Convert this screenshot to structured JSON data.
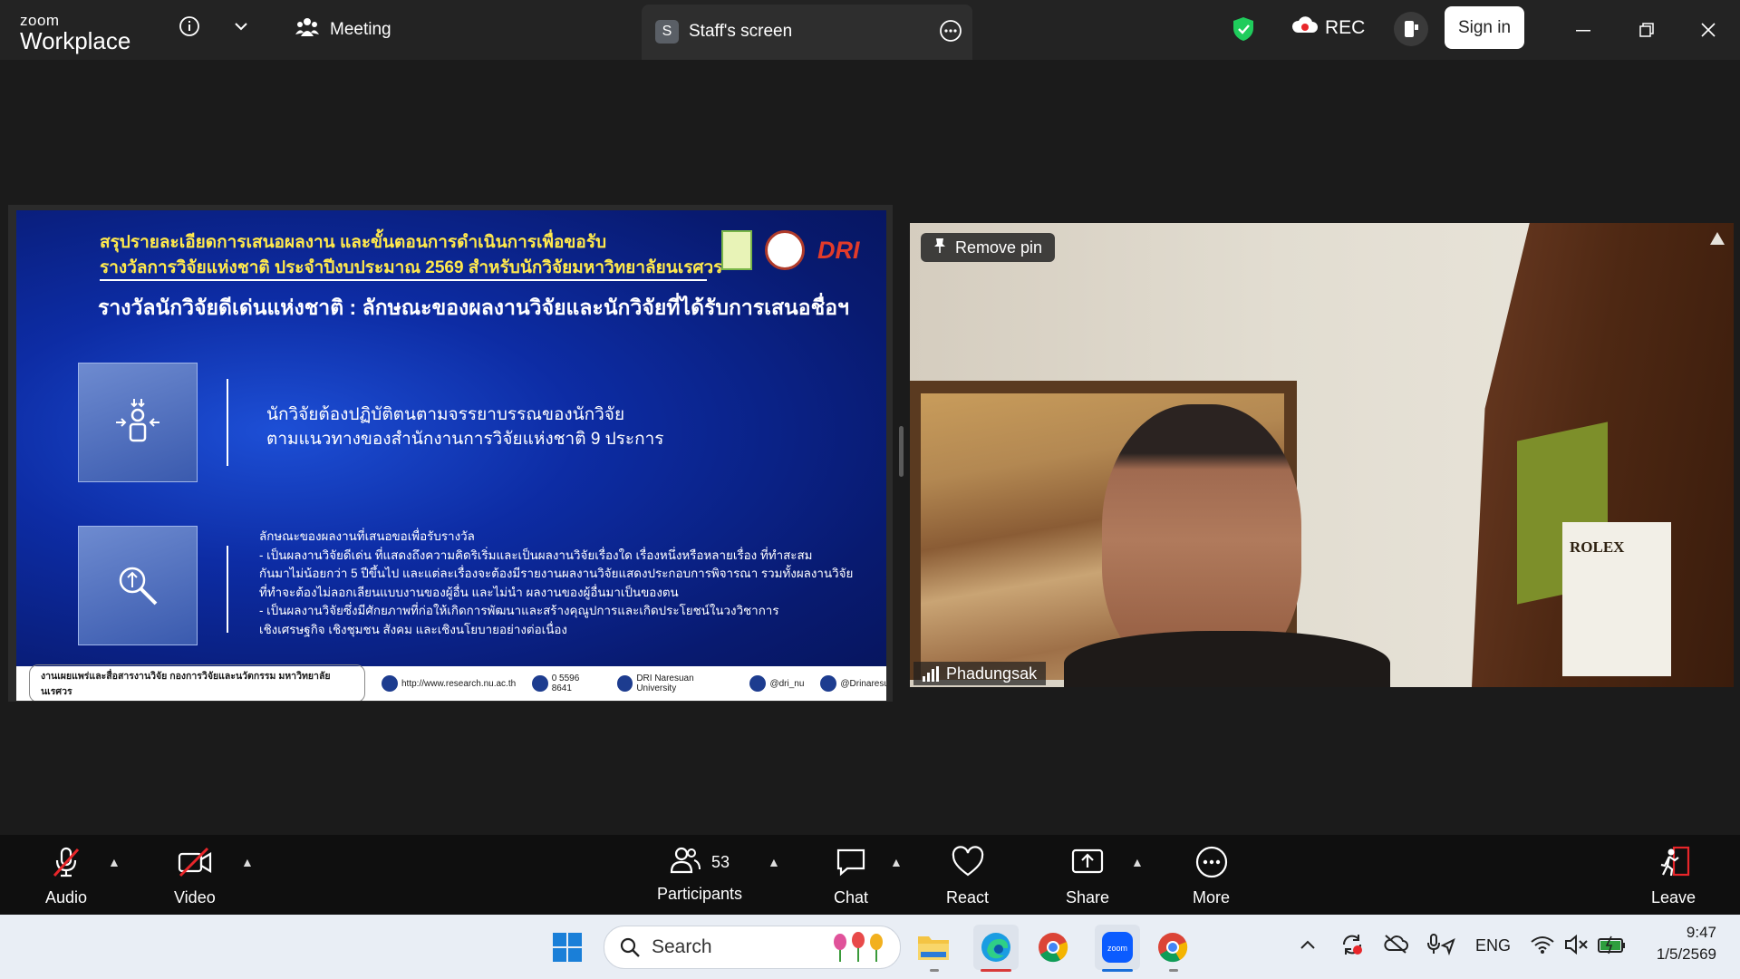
{
  "window": {
    "brand_top": "zoom",
    "brand_bottom": "Workplace",
    "meeting_tab": "Meeting",
    "share_tab_letter": "S",
    "share_tab": "Staff's screen",
    "rec_label": "REC",
    "signin_label": "Sign in"
  },
  "slide": {
    "title_line1": "สรุปรายละเอียดการเสนอผลงาน และขั้นตอนการดำเนินการเพื่อขอรับ",
    "title_line2": "รางวัลการวิจัยแห่งชาติ ประจำปีงบประมาณ 2569 สำหรับนักวิจัยมหาวิทยาลัยนเรศวร",
    "heading": "รางวัลนักวิจัยดีเด่นแห่งชาติ : ลักษณะของผลงานวิจัยและนักวิจัยที่ได้รับการเสนอชื่อฯ",
    "logo_label": "DRI",
    "block1_line1": "นักวิจัยต้องปฏิบัติตนตามจรรยาบรรณของนักวิจัย",
    "block1_line2": "ตามแนวทางของสำนักงานการวิจัยแห่งชาติ 9 ประการ",
    "block2_lines": [
      "ลักษณะของผลงานที่เสนอขอเพื่อรับรางวัล",
      "- เป็นผลงานวิจัยดีเด่น ที่แสดงถึงความคิดริเริ่มและเป็นผลงานวิจัยเรื่องใด เรื่องหนึ่งหรือหลายเรื่อง ที่ทำสะสม",
      "  กันมาไม่น้อยกว่า 5 ปีขึ้นไป และแต่ละเรื่องจะต้องมีรายงานผลงานวิจัยแสดงประกอบการพิจารณา รวมทั้งผลงานวิจัย",
      "  ที่ทำจะต้องไม่ลอกเลียนแบบงานของผู้อื่น และไม่นำ ผลงานของผู้อื่นมาเป็นของตน",
      "- เป็นผลงานวิจัยซึ่งมีศักยภาพที่ก่อให้เกิดการพัฒนาและสร้างคุณูปการและเกิดประโยชน์ในวงวิชาการ",
      "  เชิงเศรษฐกิจ เชิงชุมชน สังคม และเชิงนโยบายอย่างต่อเนื่อง"
    ],
    "footer_org": "งานเผยแพร่และสื่อสารงานวิจัย กองการวิจัยและนวัตกรรม มหาวิทยาลัยนเรศวร",
    "footer_web": "http://www.research.nu.ac.th",
    "footer_phone": "0 5596 8641",
    "footer_fb": "DRI Naresuan University",
    "footer_line": "@dri_nu",
    "footer_x": "@Drinaresuan"
  },
  "video": {
    "pin_label": "Remove pin",
    "participant_name": "Phadungsak",
    "bg_text": "ROLEX"
  },
  "controls": {
    "audio": "Audio",
    "video": "Video",
    "participants": "Participants",
    "participants_count": "53",
    "chat": "Chat",
    "react": "React",
    "share": "Share",
    "more": "More",
    "leave": "Leave"
  },
  "taskbar": {
    "search_placeholder": "Search",
    "lang": "ENG",
    "time": "9:47",
    "date": "1/5/2569"
  }
}
